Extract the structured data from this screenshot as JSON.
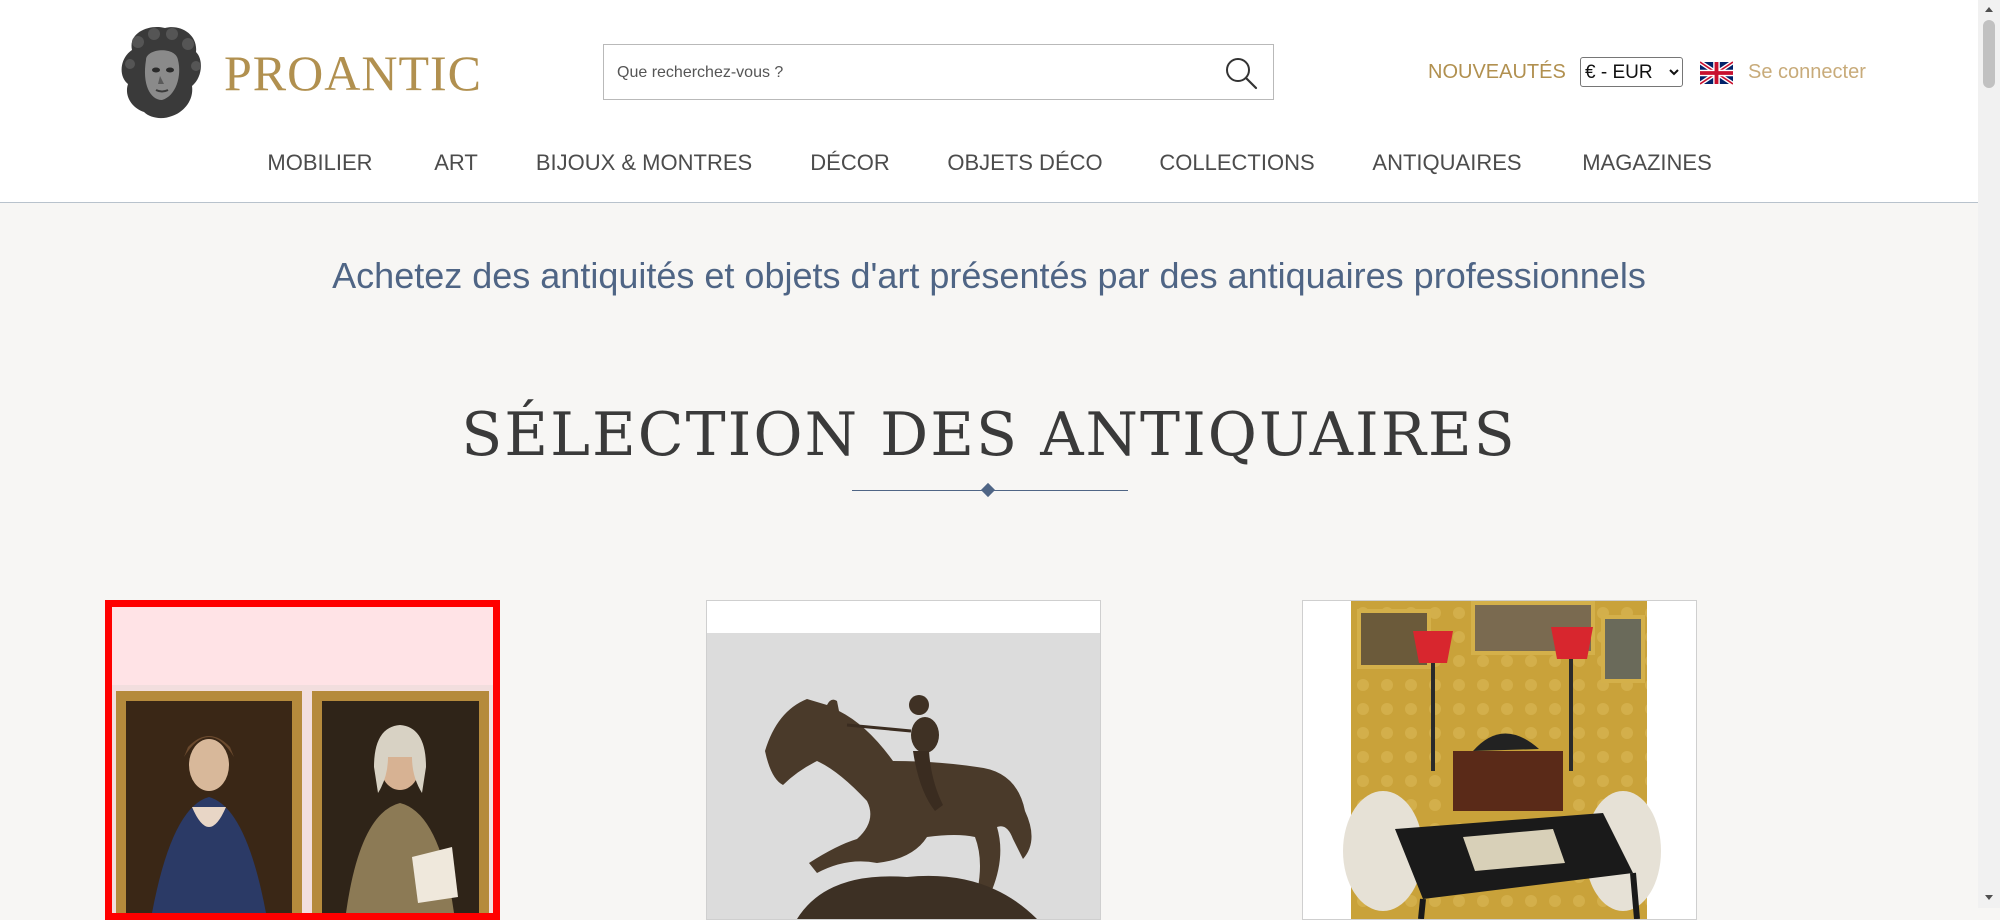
{
  "header": {
    "logo_text": "PROANTIC",
    "search": {
      "placeholder": "Que recherchez-vous ?"
    },
    "links": {
      "new": "NOUVEAUTÉS",
      "login": "Se connecter"
    },
    "currency": {
      "selected": "€ - EUR"
    },
    "language_flag": "uk-flag-icon"
  },
  "nav": {
    "items": [
      {
        "label": "MOBILIER"
      },
      {
        "label": "ART"
      },
      {
        "label": "BIJOUX & MONTRES"
      },
      {
        "label": "DÉCOR"
      },
      {
        "label": "OBJETS DÉCO"
      },
      {
        "label": "COLLECTIONS"
      },
      {
        "label": "ANTIQUAIRES"
      },
      {
        "label": "MAGAZINES"
      }
    ]
  },
  "main": {
    "tagline": "Achetez des antiquités et objets d'art présentés par des antiquaires professionnels",
    "section_title": "SÉLECTION DES ANTIQUAIRES"
  },
  "cards": [
    {
      "image": "pair-of-portraits-image",
      "selected": true
    },
    {
      "image": "bronze-horse-rider-image",
      "selected": false
    },
    {
      "image": "interior-with-chess-table-image",
      "selected": false
    }
  ],
  "colors": {
    "brand_gold": "#b1904f",
    "nav_text": "#4c4c4c",
    "tagline_blue": "#4f6585",
    "selection_red": "#ff0000"
  }
}
